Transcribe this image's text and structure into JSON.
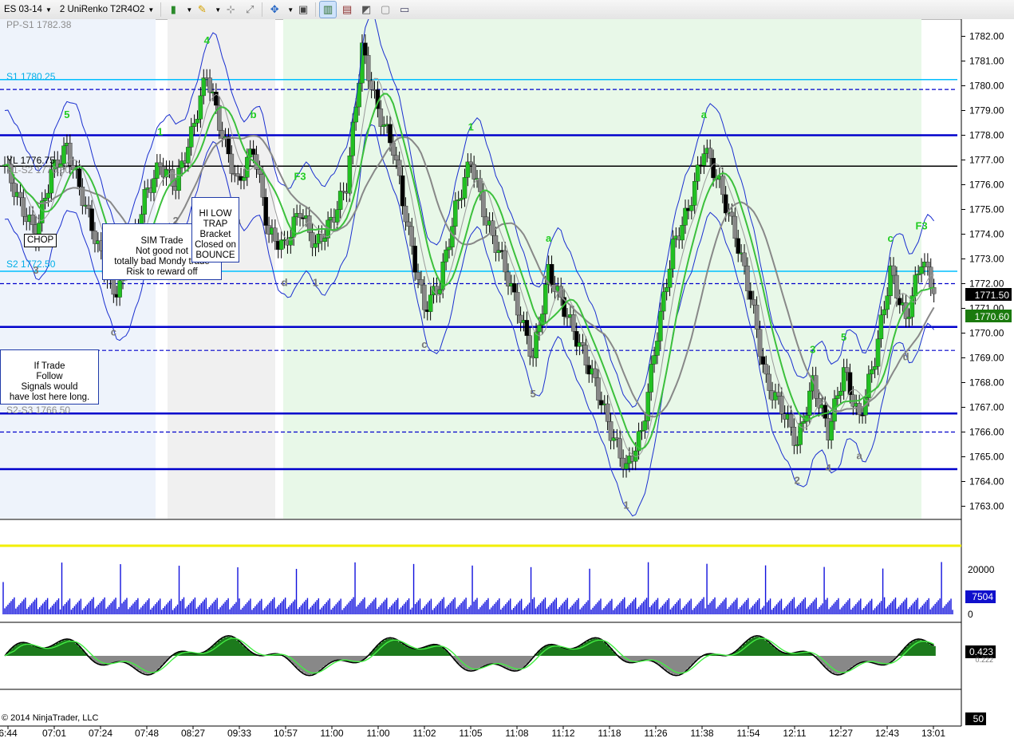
{
  "toolbar": {
    "instrument": "ES 03-14",
    "bar_type": "2 UniRenko T2R4O2",
    "icons": [
      "candlestick-icon",
      "pencil-icon",
      "crosshair-icon",
      "zoom-icon",
      "globe-icon",
      "properties-icon",
      "bars-icon",
      "strategy-icon",
      "chart-icon",
      "calculator-icon",
      "window-icon"
    ]
  },
  "price_panel": {
    "y_ticks": [
      "1782.00",
      "1781.00",
      "1780.00",
      "1779.00",
      "1778.00",
      "1777.00",
      "1776.00",
      "1775.00",
      "1774.00",
      "1773.00",
      "1772.00",
      "1771.00",
      "1770.00",
      "1769.00",
      "1768.00",
      "1767.00",
      "1766.00",
      "1765.00",
      "1764.00",
      "1763.00"
    ],
    "last_price": "1771.50",
    "last_price_color": "#000000",
    "ma_price": "1770.60",
    "ma_price_color": "#1b7a0e",
    "pivot_labels": {
      "pp_s1": "PP-S1 1782.38",
      "s1": "S1 1780.25",
      "yl": "YL 1776.75",
      "s2_pre": "S1-S2 1776.50",
      "s2": "S2 1772.50",
      "s2s3": "S2-S3 1766.50"
    },
    "annotations": {
      "chop": "CHOP",
      "sim_trade": "SIM Trade\nNot good not\ntotally bad Mondy trade\nRisk to reward off",
      "hi_low": "HI LOW\nTRAP\nBracket\nClosed on\nBOUNCE",
      "if_trade": "If Trade\nFollow\nSignals would\nhave lost here long."
    }
  },
  "volume_panel": {
    "y_ticks": [
      "20000",
      "0"
    ],
    "last_volume": "7504"
  },
  "osc_panel": {
    "value1": "0.423",
    "value2": "0.222"
  },
  "bottom_panel": {
    "value": "50",
    "copyright": "© 2014 NinjaTrader, LLC"
  },
  "x_ticks": [
    "6:44",
    "07:01",
    "07:24",
    "07:48",
    "08:27",
    "09:33",
    "10:57",
    "11:00",
    "11:00",
    "11:02",
    "11:05",
    "11:08",
    "11:12",
    "11:18",
    "11:26",
    "11:38",
    "11:54",
    "12:11",
    "12:27",
    "12:43",
    "13:01"
  ],
  "chart_data": {
    "type": "candlestick",
    "instrument": "ES 03-14",
    "bar_type": "2 UniRenko T2R4O2",
    "ylim": [
      1762.5,
      1782.5
    ],
    "y_ticks": [
      1782,
      1781,
      1780,
      1779,
      1778,
      1777,
      1776,
      1775,
      1774,
      1773,
      1772,
      1771,
      1770,
      1769,
      1768,
      1767,
      1766,
      1765,
      1764,
      1763
    ],
    "x_tick_labels": [
      "6:44",
      "07:01",
      "07:24",
      "07:48",
      "08:27",
      "09:33",
      "10:57",
      "11:00",
      "11:00",
      "11:02",
      "11:05",
      "11:08",
      "11:12",
      "11:18",
      "11:26",
      "11:38",
      "11:54",
      "12:11",
      "12:27",
      "12:43",
      "13:01"
    ],
    "close_path": [
      1776.8,
      1775.2,
      1774,
      1776.5,
      1777.5,
      1775.5,
      1773.5,
      1771.5,
      1773,
      1775.5,
      1776.8,
      1776,
      1778,
      1780.5,
      1778,
      1776,
      1777.5,
      1774,
      1773.5,
      1775,
      1773.5,
      1774.5,
      1776,
      1781.5,
      1779,
      1777.5,
      1774,
      1771,
      1772,
      1775,
      1777,
      1774.5,
      1773,
      1771,
      1769,
      1772.5,
      1771,
      1769.5,
      1768,
      1766,
      1764.5,
      1766,
      1770,
      1773.5,
      1775,
      1777.5,
      1776,
      1774,
      1771.5,
      1768,
      1767,
      1765.5,
      1768,
      1766,
      1768.5,
      1766.5,
      1769,
      1772.5,
      1770.5,
      1773,
      1771.5
    ],
    "horizontal_levels": [
      {
        "price": 1780.25,
        "label": "S1 1780.25",
        "color": "#00bfff"
      },
      {
        "price": 1772.5,
        "label": "S2 1772.50",
        "color": "#00bfff"
      },
      {
        "price": 1776.75,
        "label": "YL 1776.75",
        "color": "#000000"
      },
      {
        "price": 1779.85,
        "color": "#0000cc"
      },
      {
        "price": 1778.0,
        "color": "#0000cc"
      },
      {
        "price": 1772.0,
        "color": "#0000cc"
      },
      {
        "price": 1770.25,
        "color": "#0000cc"
      },
      {
        "price": 1769.3,
        "color": "#0000cc"
      },
      {
        "price": 1766.75,
        "color": "#0000cc"
      },
      {
        "price": 1766.0,
        "color": "#0000cc"
      },
      {
        "price": 1764.5,
        "color": "#0000cc"
      }
    ],
    "last_price": 1771.5,
    "ma_price": 1770.6,
    "volume_last": 7504,
    "volume_ylim": [
      0,
      25000
    ],
    "volume_reference": 23000,
    "oscillator": {
      "value1": 0.423,
      "value2": 0.222
    },
    "bottom_value": 50
  }
}
